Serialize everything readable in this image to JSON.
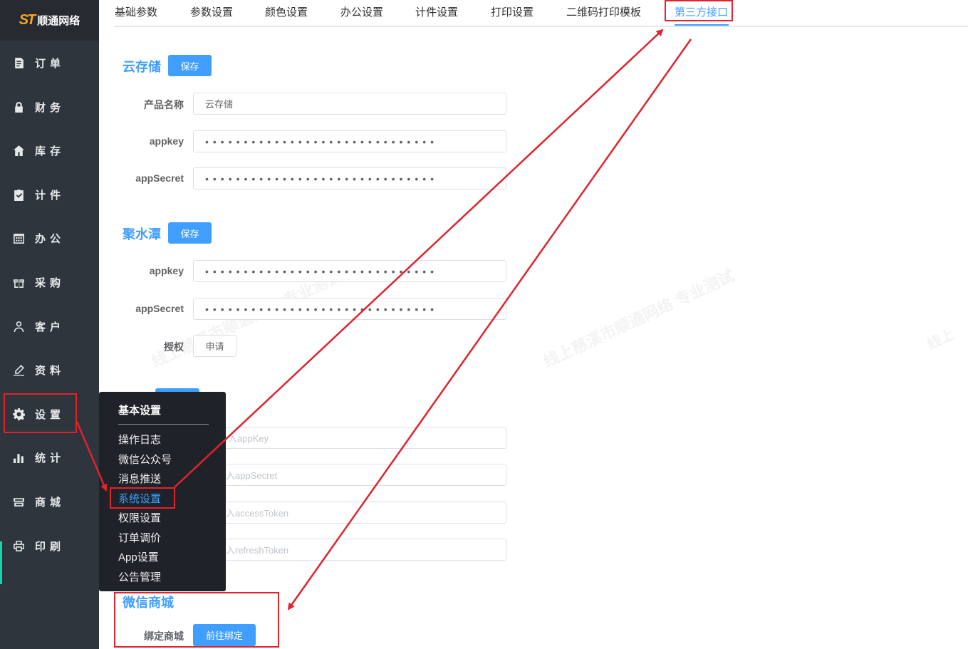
{
  "brand": {
    "logo_mark": "ST",
    "name": "顺通网络"
  },
  "sidebar": {
    "items": [
      {
        "label": "订单",
        "icon": "order-icon"
      },
      {
        "label": "财务",
        "icon": "lock-icon"
      },
      {
        "label": "库存",
        "icon": "home-icon"
      },
      {
        "label": "计件",
        "icon": "clipboard-check-icon"
      },
      {
        "label": "办公",
        "icon": "calendar-icon"
      },
      {
        "label": "采购",
        "icon": "gift-icon"
      },
      {
        "label": "客户",
        "icon": "user-icon"
      },
      {
        "label": "资料",
        "icon": "edit-icon"
      },
      {
        "label": "设置",
        "icon": "gear-icon"
      },
      {
        "label": "统计",
        "icon": "bar-chart-icon"
      },
      {
        "label": "商城",
        "icon": "store-icon"
      },
      {
        "label": "印刷",
        "icon": "printer-icon"
      }
    ]
  },
  "tabs": [
    "基础参数",
    "参数设置",
    "颜色设置",
    "办公设置",
    "计件设置",
    "打印设置",
    "二维码打印模板",
    "第三方接口"
  ],
  "sections": {
    "cloud": {
      "title": "云存储",
      "save": "保存",
      "product_label": "产品名称",
      "product_value": "云存储",
      "appkey_label": "appkey",
      "appkey_value": "••••••••••••••••••••••••••••••",
      "secret_label": "appSecret",
      "secret_value": "••••••••••••••••••••••••••••••"
    },
    "jushuitan": {
      "title": "聚水潭",
      "save": "保存",
      "appkey_label": "appkey",
      "appkey_value": "••••••••••••••••••••••••••••••",
      "secret_label": "appSecret",
      "secret_value": "••••••••••••••••••••••••••••••",
      "auth_label": "授权",
      "auth_button": "申请"
    },
    "hidden": {
      "ph_appkey": "入appKey",
      "ph_secret": "入appSecret",
      "ph_access": "入accessToken",
      "ph_refresh": "入refreshToken"
    },
    "wechat_mall": {
      "title": "微信商城",
      "bind_label": "绑定商城",
      "bind_button": "前往绑定"
    }
  },
  "dropdown": {
    "title": "基本设置",
    "items": [
      "操作日志",
      "微信公众号",
      "消息推送",
      "系统设置",
      "权限设置",
      "订单调价",
      "App设置",
      "公告管理"
    ]
  },
  "watermark": "线上慈溪市顺通网络 专业测试",
  "colors": {
    "accent": "#409eff",
    "sidebar": "#2f353d",
    "annotation": "#e0232d"
  }
}
